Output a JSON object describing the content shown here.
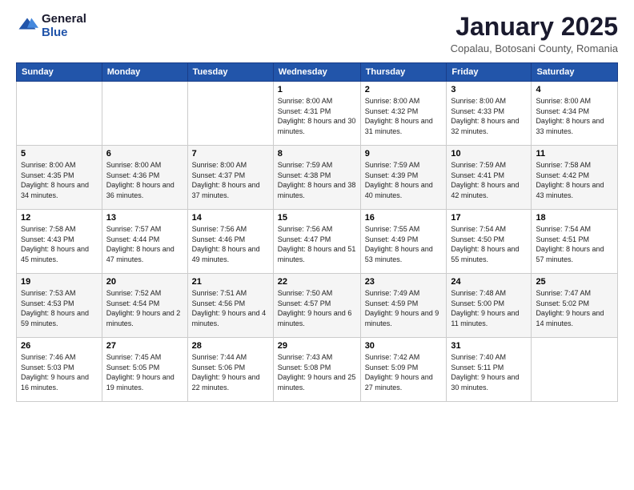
{
  "logo": {
    "general": "General",
    "blue": "Blue"
  },
  "header": {
    "month": "January 2025",
    "location": "Copalau, Botosani County, Romania"
  },
  "days_header": [
    "Sunday",
    "Monday",
    "Tuesday",
    "Wednesday",
    "Thursday",
    "Friday",
    "Saturday"
  ],
  "weeks": [
    [
      {
        "day": "",
        "sunrise": "",
        "sunset": "",
        "daylight": ""
      },
      {
        "day": "",
        "sunrise": "",
        "sunset": "",
        "daylight": ""
      },
      {
        "day": "",
        "sunrise": "",
        "sunset": "",
        "daylight": ""
      },
      {
        "day": "1",
        "sunrise": "Sunrise: 8:00 AM",
        "sunset": "Sunset: 4:31 PM",
        "daylight": "Daylight: 8 hours and 30 minutes."
      },
      {
        "day": "2",
        "sunrise": "Sunrise: 8:00 AM",
        "sunset": "Sunset: 4:32 PM",
        "daylight": "Daylight: 8 hours and 31 minutes."
      },
      {
        "day": "3",
        "sunrise": "Sunrise: 8:00 AM",
        "sunset": "Sunset: 4:33 PM",
        "daylight": "Daylight: 8 hours and 32 minutes."
      },
      {
        "day": "4",
        "sunrise": "Sunrise: 8:00 AM",
        "sunset": "Sunset: 4:34 PM",
        "daylight": "Daylight: 8 hours and 33 minutes."
      }
    ],
    [
      {
        "day": "5",
        "sunrise": "Sunrise: 8:00 AM",
        "sunset": "Sunset: 4:35 PM",
        "daylight": "Daylight: 8 hours and 34 minutes."
      },
      {
        "day": "6",
        "sunrise": "Sunrise: 8:00 AM",
        "sunset": "Sunset: 4:36 PM",
        "daylight": "Daylight: 8 hours and 36 minutes."
      },
      {
        "day": "7",
        "sunrise": "Sunrise: 8:00 AM",
        "sunset": "Sunset: 4:37 PM",
        "daylight": "Daylight: 8 hours and 37 minutes."
      },
      {
        "day": "8",
        "sunrise": "Sunrise: 7:59 AM",
        "sunset": "Sunset: 4:38 PM",
        "daylight": "Daylight: 8 hours and 38 minutes."
      },
      {
        "day": "9",
        "sunrise": "Sunrise: 7:59 AM",
        "sunset": "Sunset: 4:39 PM",
        "daylight": "Daylight: 8 hours and 40 minutes."
      },
      {
        "day": "10",
        "sunrise": "Sunrise: 7:59 AM",
        "sunset": "Sunset: 4:41 PM",
        "daylight": "Daylight: 8 hours and 42 minutes."
      },
      {
        "day": "11",
        "sunrise": "Sunrise: 7:58 AM",
        "sunset": "Sunset: 4:42 PM",
        "daylight": "Daylight: 8 hours and 43 minutes."
      }
    ],
    [
      {
        "day": "12",
        "sunrise": "Sunrise: 7:58 AM",
        "sunset": "Sunset: 4:43 PM",
        "daylight": "Daylight: 8 hours and 45 minutes."
      },
      {
        "day": "13",
        "sunrise": "Sunrise: 7:57 AM",
        "sunset": "Sunset: 4:44 PM",
        "daylight": "Daylight: 8 hours and 47 minutes."
      },
      {
        "day": "14",
        "sunrise": "Sunrise: 7:56 AM",
        "sunset": "Sunset: 4:46 PM",
        "daylight": "Daylight: 8 hours and 49 minutes."
      },
      {
        "day": "15",
        "sunrise": "Sunrise: 7:56 AM",
        "sunset": "Sunset: 4:47 PM",
        "daylight": "Daylight: 8 hours and 51 minutes."
      },
      {
        "day": "16",
        "sunrise": "Sunrise: 7:55 AM",
        "sunset": "Sunset: 4:49 PM",
        "daylight": "Daylight: 8 hours and 53 minutes."
      },
      {
        "day": "17",
        "sunrise": "Sunrise: 7:54 AM",
        "sunset": "Sunset: 4:50 PM",
        "daylight": "Daylight: 8 hours and 55 minutes."
      },
      {
        "day": "18",
        "sunrise": "Sunrise: 7:54 AM",
        "sunset": "Sunset: 4:51 PM",
        "daylight": "Daylight: 8 hours and 57 minutes."
      }
    ],
    [
      {
        "day": "19",
        "sunrise": "Sunrise: 7:53 AM",
        "sunset": "Sunset: 4:53 PM",
        "daylight": "Daylight: 8 hours and 59 minutes."
      },
      {
        "day": "20",
        "sunrise": "Sunrise: 7:52 AM",
        "sunset": "Sunset: 4:54 PM",
        "daylight": "Daylight: 9 hours and 2 minutes."
      },
      {
        "day": "21",
        "sunrise": "Sunrise: 7:51 AM",
        "sunset": "Sunset: 4:56 PM",
        "daylight": "Daylight: 9 hours and 4 minutes."
      },
      {
        "day": "22",
        "sunrise": "Sunrise: 7:50 AM",
        "sunset": "Sunset: 4:57 PM",
        "daylight": "Daylight: 9 hours and 6 minutes."
      },
      {
        "day": "23",
        "sunrise": "Sunrise: 7:49 AM",
        "sunset": "Sunset: 4:59 PM",
        "daylight": "Daylight: 9 hours and 9 minutes."
      },
      {
        "day": "24",
        "sunrise": "Sunrise: 7:48 AM",
        "sunset": "Sunset: 5:00 PM",
        "daylight": "Daylight: 9 hours and 11 minutes."
      },
      {
        "day": "25",
        "sunrise": "Sunrise: 7:47 AM",
        "sunset": "Sunset: 5:02 PM",
        "daylight": "Daylight: 9 hours and 14 minutes."
      }
    ],
    [
      {
        "day": "26",
        "sunrise": "Sunrise: 7:46 AM",
        "sunset": "Sunset: 5:03 PM",
        "daylight": "Daylight: 9 hours and 16 minutes."
      },
      {
        "day": "27",
        "sunrise": "Sunrise: 7:45 AM",
        "sunset": "Sunset: 5:05 PM",
        "daylight": "Daylight: 9 hours and 19 minutes."
      },
      {
        "day": "28",
        "sunrise": "Sunrise: 7:44 AM",
        "sunset": "Sunset: 5:06 PM",
        "daylight": "Daylight: 9 hours and 22 minutes."
      },
      {
        "day": "29",
        "sunrise": "Sunrise: 7:43 AM",
        "sunset": "Sunset: 5:08 PM",
        "daylight": "Daylight: 9 hours and 25 minutes."
      },
      {
        "day": "30",
        "sunrise": "Sunrise: 7:42 AM",
        "sunset": "Sunset: 5:09 PM",
        "daylight": "Daylight: 9 hours and 27 minutes."
      },
      {
        "day": "31",
        "sunrise": "Sunrise: 7:40 AM",
        "sunset": "Sunset: 5:11 PM",
        "daylight": "Daylight: 9 hours and 30 minutes."
      },
      {
        "day": "",
        "sunrise": "",
        "sunset": "",
        "daylight": ""
      }
    ]
  ]
}
